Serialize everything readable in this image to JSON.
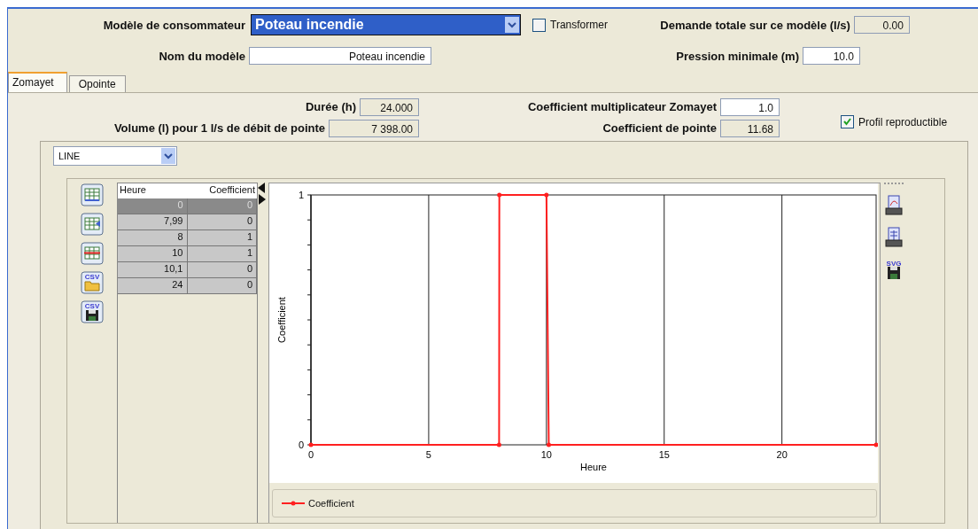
{
  "header": {
    "consumer_model_label": "Modèle de consommateur",
    "consumer_model_value": "Poteau incendie",
    "transform": {
      "label": "Transformer",
      "checked": false
    },
    "total_demand_label": "Demande totale sur ce modèle (l/s)",
    "total_demand_value": "0.00",
    "model_name_label": "Nom du modèle",
    "model_name_value": "Poteau incendie",
    "min_pressure_label": "Pression minimale (m)",
    "min_pressure_value": "10.0"
  },
  "tabs": [
    {
      "label": "Zomayet",
      "selected": true
    },
    {
      "label": "Opointe",
      "selected": false
    }
  ],
  "params": {
    "duration_label": "Durée (h)",
    "duration_value": "24.000",
    "volume_label": "Volume (l) pour 1 l/s de débit de pointe",
    "volume_value": "7 398.00",
    "multiplier_label": "Coefficient multiplicateur Zomayet",
    "multiplier_value": "1.0",
    "peak_label": "Coefficient de pointe",
    "peak_value": "11.68",
    "reproducible": {
      "label": "Profil reproductible",
      "checked": true
    }
  },
  "chart_type": "LINE",
  "left_toolbar": [
    {
      "kind": "grid-add"
    },
    {
      "kind": "grid-insert"
    },
    {
      "kind": "grid-delete"
    },
    {
      "kind": "open",
      "caption": "CSV"
    },
    {
      "kind": "save",
      "caption": "CSV"
    }
  ],
  "table": {
    "columns": [
      "Heure",
      "Coefficient"
    ],
    "rows": [
      {
        "cells": [
          "0",
          "0"
        ],
        "selected": true
      },
      {
        "cells": [
          "7,99",
          "0"
        ],
        "selected": false
      },
      {
        "cells": [
          "8",
          "1"
        ],
        "selected": false
      },
      {
        "cells": [
          "10",
          "1"
        ],
        "selected": false
      },
      {
        "cells": [
          "10,1",
          "0"
        ],
        "selected": false
      },
      {
        "cells": [
          "24",
          "0"
        ],
        "selected": false
      }
    ]
  },
  "chart": {
    "chart_data": {
      "type": "line",
      "xlabel": "Heure",
      "ylabel": "Coefficient",
      "x": [
        0,
        7.99,
        8,
        10,
        10.1,
        24
      ],
      "series": [
        {
          "name": "Coefficient",
          "color": "#ff2020",
          "values": [
            0,
            0,
            1,
            1,
            0,
            0
          ]
        }
      ],
      "xlim": [
        0,
        24
      ],
      "ylim": [
        0,
        1
      ],
      "xticks": [
        0,
        5,
        10,
        15,
        20
      ],
      "yticks": [
        0,
        1
      ],
      "grid": true
    }
  },
  "right_toolbar": [
    {
      "kind": "print-chart"
    },
    {
      "kind": "print-table"
    },
    {
      "kind": "save",
      "caption": "SVG"
    }
  ]
}
